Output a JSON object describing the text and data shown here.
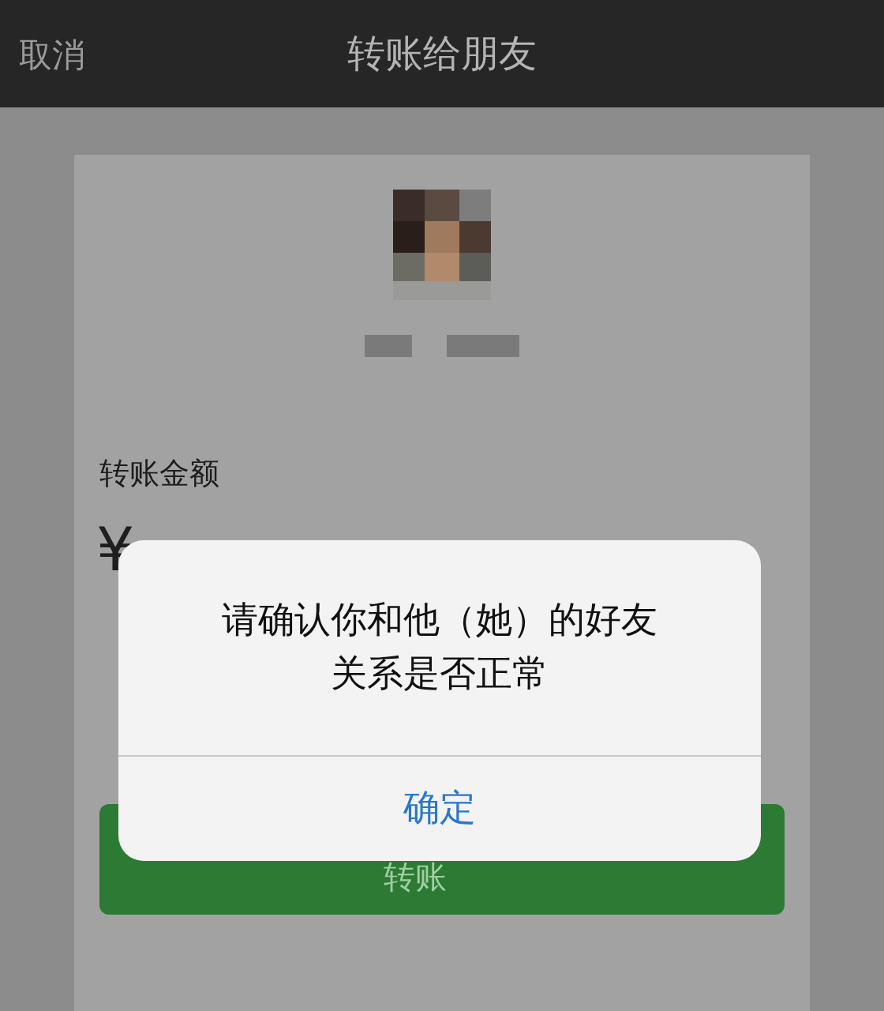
{
  "header": {
    "cancel": "取消",
    "title": "转账给朋友"
  },
  "amount_label": "转账金额",
  "amount": "¥",
  "transfer_button": "转账",
  "dialog": {
    "message_lines": [
      "请确认你和他（她）的好友",
      "关系是否正常"
    ],
    "button": "确定"
  }
}
